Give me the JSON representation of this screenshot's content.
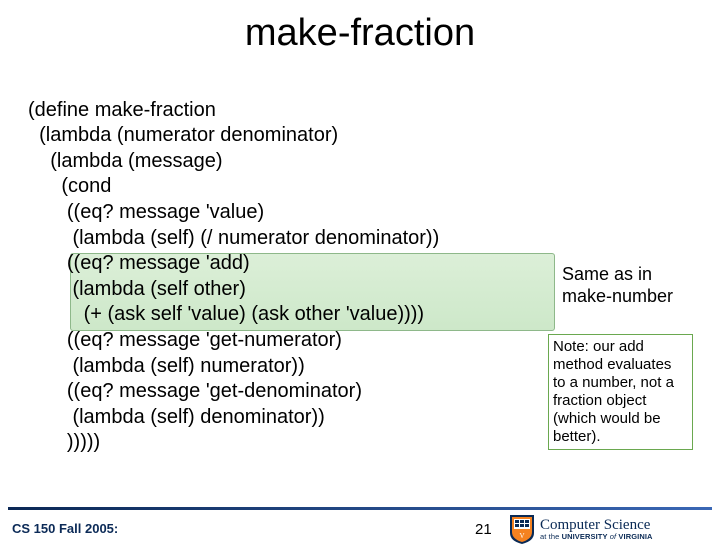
{
  "title": "make-fraction",
  "code": {
    "l1": "(define make-fraction",
    "l2": "  (lambda (numerator denominator)",
    "l3": "    (lambda (message)",
    "l4": "      (cond",
    "l5": "       ((eq? message 'value)",
    "l6": "        (lambda (self) (/ numerator denominator))",
    "l7": "       ((eq? message 'add)",
    "l8": "        (lambda (self other)",
    "l9": "          (+ (ask self 'value) (ask other 'value))))",
    "l10": "       ((eq? message 'get-numerator)",
    "l11": "        (lambda (self) numerator))",
    "l12": "       ((eq? message 'get-denominator)",
    "l13": "        (lambda (self) denominator))",
    "l14": "       )))))"
  },
  "annotation": {
    "line1": "Same as in",
    "line2": "make-number"
  },
  "note": "Note: our add method evaluates to a number, not a fraction object (which would be better).",
  "footer": {
    "course": "CS 150 Fall 2005:",
    "page": "21",
    "logo_cs": "Computer Science",
    "logo_uva_prefix": "at the ",
    "logo_uva_main": "UNIVERSITY",
    "logo_uva_of": " of ",
    "logo_uva_v": "VIRGINIA"
  }
}
